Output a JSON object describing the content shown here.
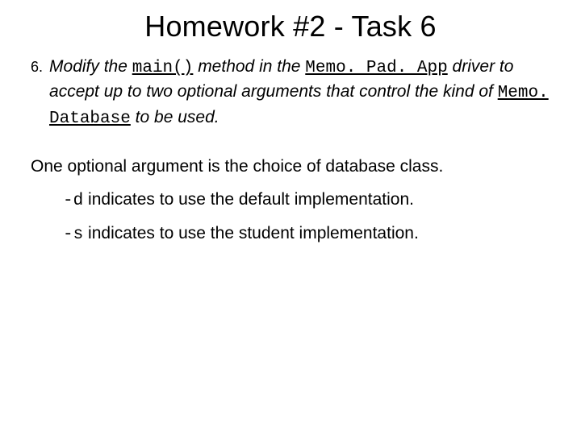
{
  "title": "Homework #2 - Task 6",
  "item_number": "6.",
  "task": {
    "p1a": "Modify the ",
    "code1": "main()",
    "p1b": " method in the ",
    "code2": "Memo. Pad. App",
    "p1c": " driver to accept up to two optional arguments that control the kind of ",
    "code3": "Memo. Database",
    "p1d": " to be used."
  },
  "body": {
    "lead": "One optional argument is the choice of database class.",
    "opt_d_code": "-d",
    "opt_d_text": " indicates to use the default implementation.",
    "opt_s_code": "-s",
    "opt_s_text": " indicates to use the student implementation."
  }
}
